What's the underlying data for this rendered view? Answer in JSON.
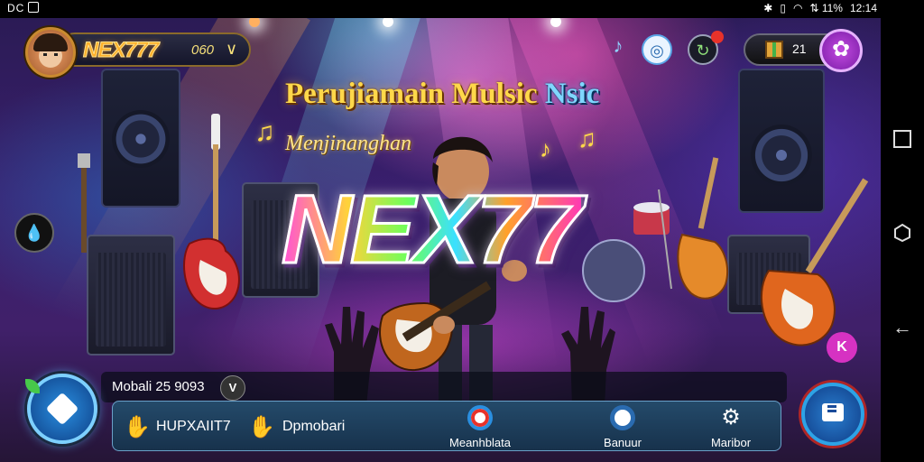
{
  "status_bar": {
    "left_text": "DC",
    "signal_text": "⇅ 11%",
    "time": "12:14"
  },
  "hud": {
    "player_name": "NEX777",
    "player_value": "060",
    "gift_count": "21"
  },
  "banner": {
    "line1_gold": "Perujiamain Mulsic ",
    "line1_blue": "Nsic",
    "line2": "Menjinanghan",
    "logo": "NEX77"
  },
  "info_strip": {
    "text": "Mobali 25 9093",
    "badge": "V"
  },
  "dock": {
    "item1_label": "HUPXAIIT7",
    "item2_label": "Dpmobari",
    "item3_caption": "Meanhblata",
    "item4_caption": "Banuur",
    "item5_caption": "Maribor"
  },
  "side": {
    "share_label": "K"
  },
  "icons": {
    "accent_gold": "#ffb02a",
    "accent_purple": "#c24be0",
    "dock_bg": "#244a6a"
  }
}
